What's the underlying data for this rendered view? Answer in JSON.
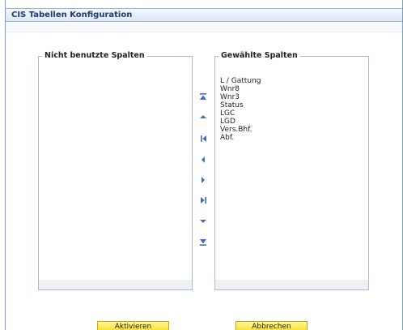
{
  "dialog": {
    "title": "CIS Tabellen Konfiguration"
  },
  "available": {
    "legend": "Nicht benutzte Spalten",
    "items": []
  },
  "selected": {
    "legend": "Gewählte Spalten",
    "items": [
      "L / Gattung",
      "Wnr8",
      "Wnr3",
      "Status",
      "LGC",
      "LGD",
      "Vers.Bhf.",
      "Abf."
    ]
  },
  "movers": [
    {
      "name": "move-to-top-icon"
    },
    {
      "name": "move-up-icon"
    },
    {
      "name": "move-all-left-icon"
    },
    {
      "name": "move-left-icon"
    },
    {
      "name": "move-right-icon"
    },
    {
      "name": "move-all-right-icon"
    },
    {
      "name": "move-down-icon"
    },
    {
      "name": "move-to-bottom-icon"
    }
  ],
  "buttons": {
    "activate": "Aktivieren",
    "cancel": "Abbrechen"
  },
  "colors": {
    "accent": "#3d6cc1",
    "button": "#f7dc1a",
    "border": "#a9bdd8",
    "title": "#1e3a6e"
  }
}
